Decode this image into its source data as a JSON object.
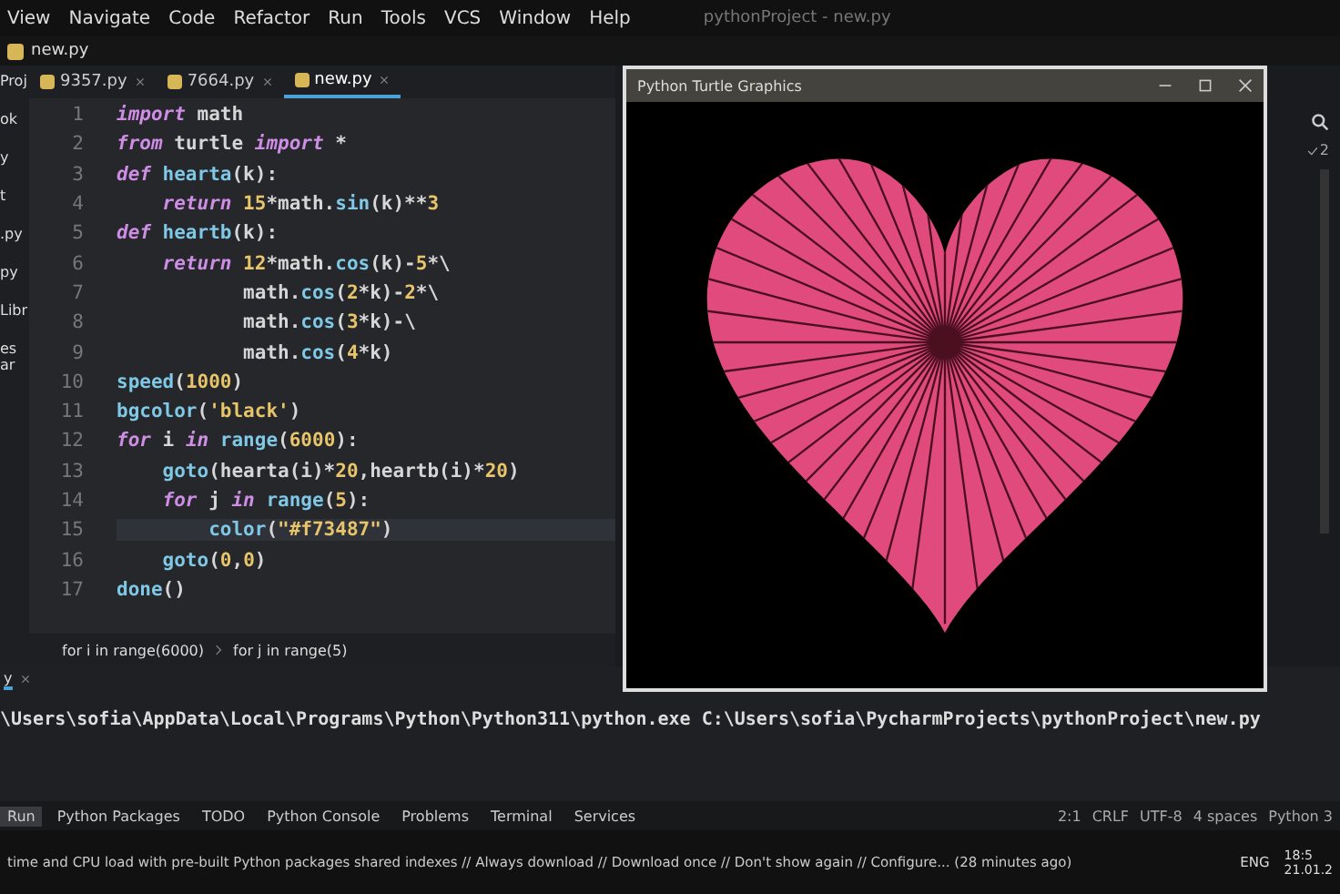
{
  "menu_bar": {
    "items": [
      "View",
      "Navigate",
      "Code",
      "Refactor",
      "Run",
      "Tools",
      "VCS",
      "Window",
      "Help"
    ],
    "title": "pythonProject - new.py"
  },
  "nav_bar": {
    "file": "new.py"
  },
  "project_panel": {
    "title": "Proj",
    "items": [
      "ok",
      "y",
      "t",
      ".py",
      "py",
      "Libr",
      "es ar"
    ]
  },
  "editor_tabs": [
    {
      "label": "9357.py",
      "selected": false
    },
    {
      "label": "7664.py",
      "selected": false
    },
    {
      "label": "new.py",
      "selected": true
    }
  ],
  "code_lines": [
    {
      "number": "1",
      "current": false,
      "tokens": [
        {
          "kind": "keyword",
          "text": "import"
        },
        {
          "kind": "plain",
          "text": " math"
        }
      ]
    },
    {
      "number": "2",
      "current": false,
      "tokens": [
        {
          "kind": "keyword",
          "text": "from"
        },
        {
          "kind": "plain",
          "text": " turtle "
        },
        {
          "kind": "keyword",
          "text": "import"
        },
        {
          "kind": "plain",
          "text": " *"
        }
      ]
    },
    {
      "number": "3",
      "current": false,
      "tokens": [
        {
          "kind": "keyword",
          "text": "def"
        },
        {
          "kind": "function",
          "text": " hearta"
        },
        {
          "kind": "plain",
          "text": "(k):"
        }
      ]
    },
    {
      "number": "4",
      "current": false,
      "tokens": [
        {
          "kind": "keyword",
          "text": "    return"
        },
        {
          "kind": "number",
          "text": " 15"
        },
        {
          "kind": "plain",
          "text": "*math."
        },
        {
          "kind": "function",
          "text": "sin"
        },
        {
          "kind": "plain",
          "text": "(k)**"
        },
        {
          "kind": "number",
          "text": "3"
        }
      ]
    },
    {
      "number": "5",
      "current": false,
      "tokens": [
        {
          "kind": "keyword",
          "text": "def"
        },
        {
          "kind": "function",
          "text": " heartb"
        },
        {
          "kind": "plain",
          "text": "(k):"
        }
      ]
    },
    {
      "number": "6",
      "current": false,
      "tokens": [
        {
          "kind": "keyword",
          "text": "    return"
        },
        {
          "kind": "number",
          "text": " 12"
        },
        {
          "kind": "plain",
          "text": "*math."
        },
        {
          "kind": "function",
          "text": "cos"
        },
        {
          "kind": "plain",
          "text": "(k)-"
        },
        {
          "kind": "number",
          "text": "5"
        },
        {
          "kind": "plain",
          "text": "*\\"
        }
      ]
    },
    {
      "number": "7",
      "current": false,
      "tokens": [
        {
          "kind": "plain",
          "text": "           math."
        },
        {
          "kind": "function",
          "text": "cos"
        },
        {
          "kind": "plain",
          "text": "("
        },
        {
          "kind": "number",
          "text": "2"
        },
        {
          "kind": "plain",
          "text": "*k)-"
        },
        {
          "kind": "number",
          "text": "2"
        },
        {
          "kind": "plain",
          "text": "*\\"
        }
      ]
    },
    {
      "number": "8",
      "current": false,
      "tokens": [
        {
          "kind": "plain",
          "text": "           math."
        },
        {
          "kind": "function",
          "text": "cos"
        },
        {
          "kind": "plain",
          "text": "("
        },
        {
          "kind": "number",
          "text": "3"
        },
        {
          "kind": "plain",
          "text": "*k)-\\"
        }
      ]
    },
    {
      "number": "9",
      "current": false,
      "tokens": [
        {
          "kind": "plain",
          "text": "           math."
        },
        {
          "kind": "function",
          "text": "cos"
        },
        {
          "kind": "plain",
          "text": "("
        },
        {
          "kind": "number",
          "text": "4"
        },
        {
          "kind": "plain",
          "text": "*k)"
        }
      ]
    },
    {
      "number": "10",
      "current": false,
      "tokens": [
        {
          "kind": "function",
          "text": "speed"
        },
        {
          "kind": "plain",
          "text": "("
        },
        {
          "kind": "number",
          "text": "1000"
        },
        {
          "kind": "plain",
          "text": ")"
        }
      ]
    },
    {
      "number": "11",
      "current": false,
      "tokens": [
        {
          "kind": "function",
          "text": "bgcolor"
        },
        {
          "kind": "plain",
          "text": "("
        },
        {
          "kind": "string",
          "text": "'black'"
        },
        {
          "kind": "plain",
          "text": ")"
        }
      ]
    },
    {
      "number": "12",
      "current": false,
      "tokens": [
        {
          "kind": "keyword",
          "text": "for"
        },
        {
          "kind": "plain",
          "text": " i "
        },
        {
          "kind": "keyword",
          "text": "in"
        },
        {
          "kind": "function",
          "text": " range"
        },
        {
          "kind": "plain",
          "text": "("
        },
        {
          "kind": "number",
          "text": "6000"
        },
        {
          "kind": "plain",
          "text": "):"
        }
      ]
    },
    {
      "number": "13",
      "current": false,
      "tokens": [
        {
          "kind": "function",
          "text": "    goto"
        },
        {
          "kind": "plain",
          "text": "(hearta(i)*"
        },
        {
          "kind": "number",
          "text": "20"
        },
        {
          "kind": "plain",
          "text": ",heartb(i)*"
        },
        {
          "kind": "number",
          "text": "20"
        },
        {
          "kind": "plain",
          "text": ")"
        }
      ]
    },
    {
      "number": "14",
      "current": false,
      "tokens": [
        {
          "kind": "keyword",
          "text": "    for"
        },
        {
          "kind": "plain",
          "text": " j "
        },
        {
          "kind": "keyword",
          "text": "in"
        },
        {
          "kind": "function",
          "text": " range"
        },
        {
          "kind": "plain",
          "text": "("
        },
        {
          "kind": "number",
          "text": "5"
        },
        {
          "kind": "plain",
          "text": "):"
        }
      ]
    },
    {
      "number": "15",
      "current": true,
      "tokens": [
        {
          "kind": "function",
          "text": "        color"
        },
        {
          "kind": "plain",
          "text": "("
        },
        {
          "kind": "string",
          "text": "\"#f73487\""
        },
        {
          "kind": "plain",
          "text": ")"
        }
      ]
    },
    {
      "number": "16",
      "current": false,
      "tokens": [
        {
          "kind": "function",
          "text": "    goto"
        },
        {
          "kind": "plain",
          "text": "("
        },
        {
          "kind": "number",
          "text": "0"
        },
        {
          "kind": "plain",
          "text": ","
        },
        {
          "kind": "number",
          "text": "0"
        },
        {
          "kind": "plain",
          "text": ")"
        }
      ]
    },
    {
      "number": "17",
      "current": false,
      "tokens": [
        {
          "kind": "function",
          "text": "done"
        },
        {
          "kind": "plain",
          "text": "()"
        }
      ]
    }
  ],
  "breadcrumbs": [
    "for i in range(6000)",
    "for j in range(5)"
  ],
  "turtle_window": {
    "title": "Python Turtle Graphics"
  },
  "right_gutter": {
    "problems_count": "2"
  },
  "run_panel": {
    "tab": "y",
    "output": "\\Users\\sofia\\AppData\\Local\\Programs\\Python\\Python311\\python.exe C:\\Users\\sofia\\PycharmProjects\\pythonProject\\new.py"
  },
  "tool_windows": [
    {
      "label": "Run",
      "selected": true
    },
    {
      "label": "Python Packages",
      "selected": false
    },
    {
      "label": "TODO",
      "selected": false
    },
    {
      "label": "Python Console",
      "selected": false
    },
    {
      "label": "Problems",
      "selected": false
    },
    {
      "label": "Terminal",
      "selected": false
    },
    {
      "label": "Services",
      "selected": false
    }
  ],
  "status_bar": {
    "message": "time and CPU load with pre-built Python packages shared indexes // Always download // Download once // Don't show again // Configure... (28 minutes ago)",
    "items": [
      "2:1",
      "CRLF",
      "UTF-8",
      "4 spaces",
      "Python 3"
    ]
  },
  "taskbar": {
    "language": "ENG",
    "time": "18:5",
    "date": "21.01.2"
  }
}
